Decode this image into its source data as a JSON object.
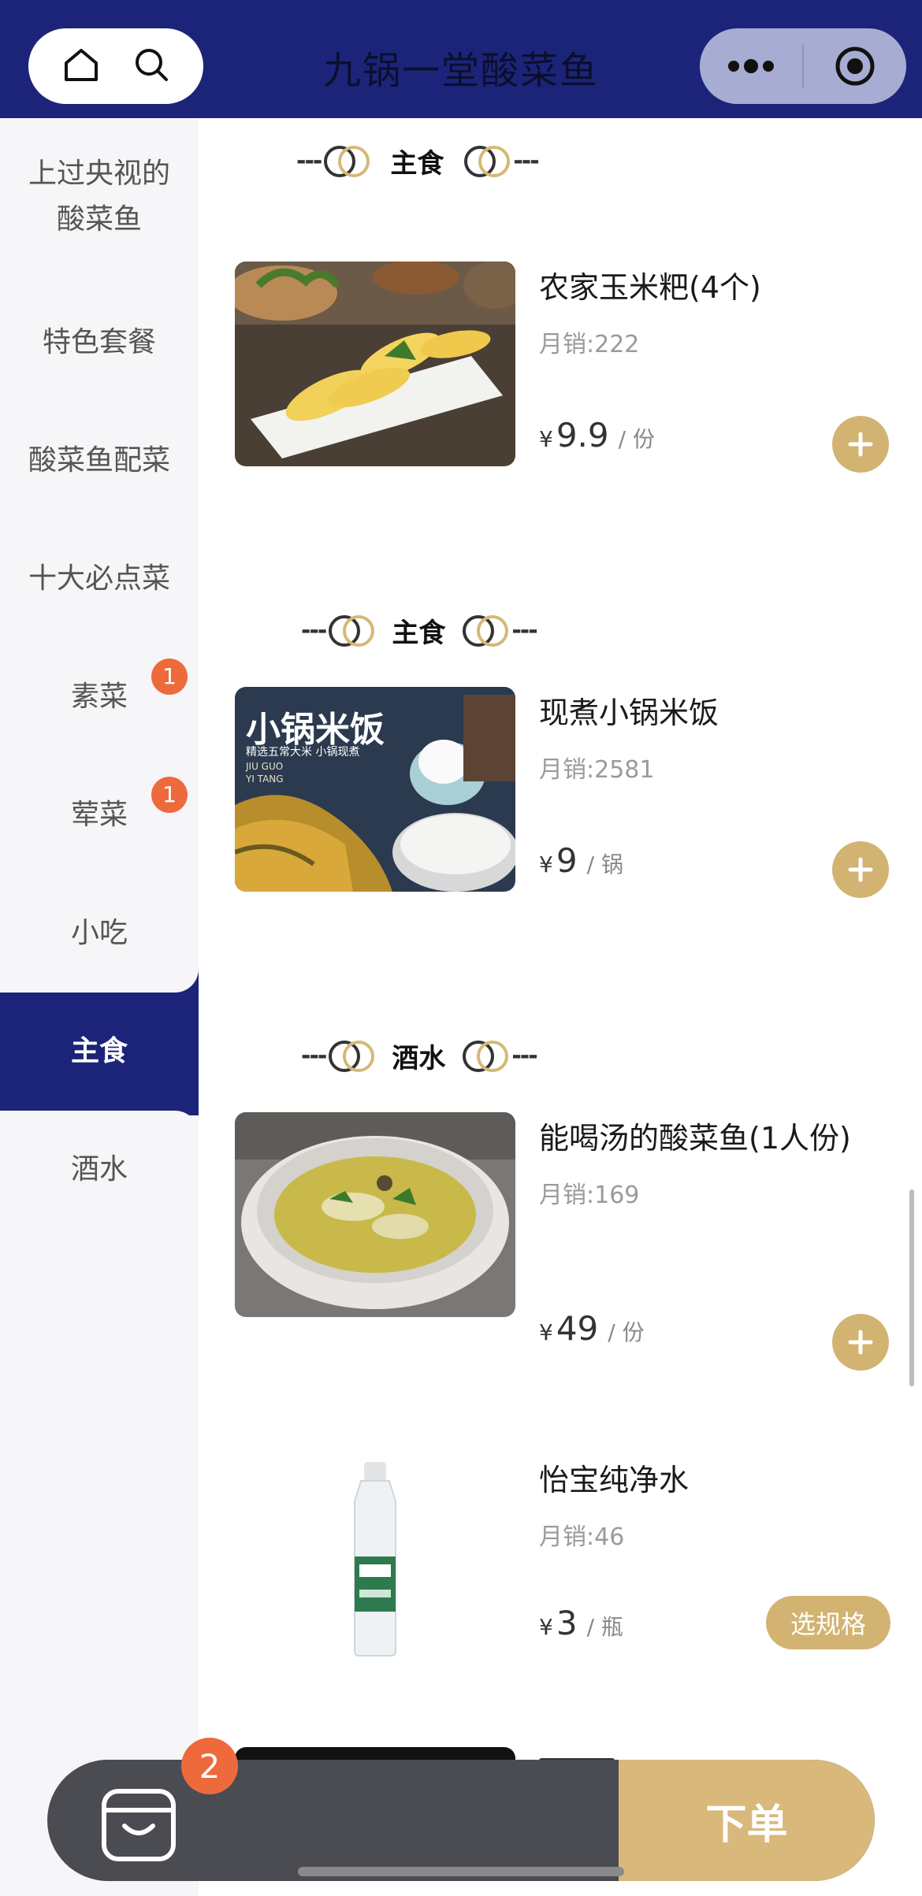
{
  "header": {
    "title": "九锅一堂酸菜鱼",
    "left_icons": [
      "home-icon",
      "search-icon"
    ],
    "right_icons": [
      "more-icon",
      "target-icon"
    ],
    "colors": {
      "bar": "#1c2479",
      "accent": "#d3b372",
      "badge": "#ee6a3c"
    }
  },
  "sidebar": {
    "items": [
      {
        "label": "上过央视的\n酸菜鱼"
      },
      {
        "label": "特色套餐"
      },
      {
        "label": "酸菜鱼配菜"
      },
      {
        "label": "十大必点菜"
      },
      {
        "label": "素菜",
        "badge": "1"
      },
      {
        "label": "荤菜",
        "badge": "1"
      },
      {
        "label": "小吃"
      },
      {
        "label": "主食",
        "active": true
      },
      {
        "label": "酒水"
      }
    ]
  },
  "sections": [
    {
      "label": "主食"
    },
    {
      "label": "主食"
    },
    {
      "label": "酒水"
    }
  ],
  "products": [
    {
      "name": "农家玉米粑(4个)",
      "sales": "月销:222",
      "currency": "¥",
      "price": "9.9",
      "unit": "/ 份",
      "action": "add"
    },
    {
      "name": "现煮小锅米饭",
      "sales": "月销:2581",
      "currency": "¥",
      "price": "9",
      "unit": "/ 锅",
      "action": "add",
      "image_text": {
        "title": "小锅米饭",
        "subtitle": "精选五常大米 小锅现煮",
        "brand1": "JIU GUO",
        "brand2": "YI TANG"
      }
    },
    {
      "name": "能喝汤的酸菜鱼(1人份)",
      "sales": "月销:169",
      "currency": "¥",
      "price": "49",
      "unit": "/ 份",
      "action": "add"
    },
    {
      "name": "怡宝纯净水",
      "sales": "月销:46",
      "currency": "¥",
      "price": "3",
      "unit": "/ 瓶",
      "action": "spec",
      "action_label": "选规格"
    }
  ],
  "cart": {
    "count": "2",
    "order_label": "下单"
  }
}
